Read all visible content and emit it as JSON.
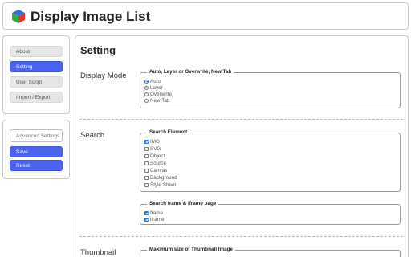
{
  "app": {
    "title": "Display Image List",
    "logo_icon": "cube-icon"
  },
  "nav": {
    "items": [
      {
        "label": "About",
        "active": false
      },
      {
        "label": "Setting",
        "active": true
      },
      {
        "label": "User Script",
        "active": false
      },
      {
        "label": "Import / Export",
        "active": false
      }
    ]
  },
  "actions": {
    "advanced_label": "Advanced Settings",
    "save_label": "Save",
    "reset_label": "Reset"
  },
  "colors": {
    "accent": "#4a63f0",
    "check_blue": "#1a73e8"
  },
  "page": {
    "title": "Setting"
  },
  "display_mode": {
    "label": "Display Mode",
    "legend": "Auto, Layer or Overwrite, New Tab",
    "options": [
      {
        "label": "Auto",
        "checked": true
      },
      {
        "label": "Layer",
        "checked": false
      },
      {
        "label": "Overwrite",
        "checked": false
      },
      {
        "label": "New Tab",
        "checked": false
      }
    ]
  },
  "search": {
    "label": "Search",
    "element_legend": "Search Element",
    "elements": [
      {
        "label": "IMG",
        "checked": true
      },
      {
        "label": "SVG",
        "checked": false
      },
      {
        "label": "Object",
        "checked": false
      },
      {
        "label": "Source",
        "checked": false
      },
      {
        "label": "Canvas",
        "checked": false
      },
      {
        "label": "Background",
        "checked": false
      },
      {
        "label": "Style Sheet",
        "checked": false
      }
    ],
    "frame_legend": "Search frame & iframe page",
    "frames": [
      {
        "label": "frame",
        "checked": true
      },
      {
        "label": "iframe",
        "checked": true
      }
    ]
  },
  "thumbnail": {
    "label": "Thumbnail",
    "legend": "Maximum size of Thumbnail Image"
  }
}
